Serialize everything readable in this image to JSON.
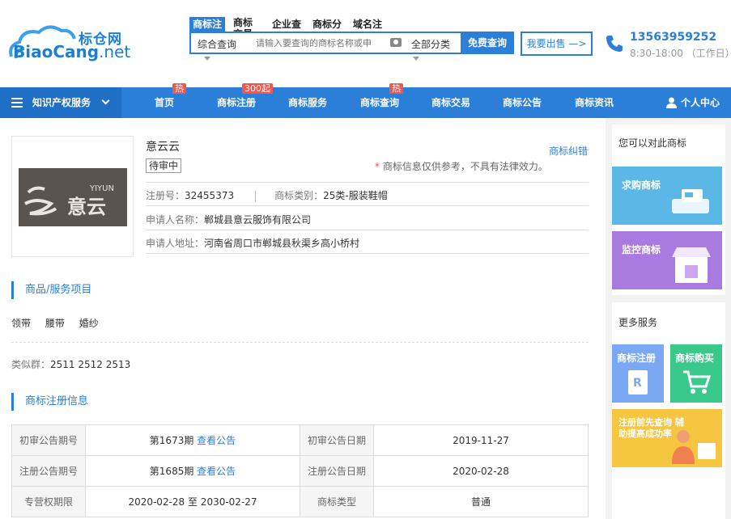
{
  "header": {
    "logo_cn": "标仓网",
    "logo_en_main": "BiaoCang",
    "logo_en_suffix": ".net",
    "search_tabs": [
      "商标注",
      "商标交易",
      "企业查",
      "商标分",
      "域名注"
    ],
    "search_category": "综合查询",
    "search_placeholder": "请输入要查询的商标名称或申",
    "search_all_category": "全部分类",
    "search_button": "免费查询",
    "sell_button": "我要出售 —>",
    "phone_number": "13563959252",
    "phone_hours": "8:30-18:00 （工作日）"
  },
  "nav": {
    "ip_services": "知识产权服务",
    "items": [
      {
        "label": "首页",
        "badge": "热"
      },
      {
        "label": "商标注册",
        "badge": "300起"
      },
      {
        "label": "商标服务",
        "badge": ""
      },
      {
        "label": "商标查询",
        "badge": "热"
      },
      {
        "label": "商标交易",
        "badge": ""
      },
      {
        "label": "商标公告",
        "badge": ""
      },
      {
        "label": "商标资讯",
        "badge": ""
      }
    ],
    "user_center": "个人中心"
  },
  "trademark": {
    "image_text_en": "YIYUN",
    "image_text_cn": "意云",
    "name": "意云云",
    "status": "待审中",
    "dispute_link": "商标纠错",
    "note_star": "*",
    "note": " 商标信息仅供参考，不具有法律效力。",
    "reg_no_label": "注册号：",
    "reg_no": "32455373",
    "class_label": "商标类别：",
    "class_value": "25类-服装鞋帽",
    "applicant_label": "申请人名称：",
    "applicant": "郸城县意云服饰有限公司",
    "address_label": "申请人地址：",
    "address": "河南省周口市郸城县秋渠乡高小桥村"
  },
  "goods_section": {
    "title": "商品/服务项目",
    "items": [
      "领带",
      "腰带",
      "婚纱"
    ],
    "similar_label": "类似群：",
    "similar_value": "2511 2512 2513"
  },
  "reg_section": {
    "title": "商标注册信息",
    "rows": [
      {
        "h1": "初审公告期号",
        "v1": "第1673期",
        "v1_link": "查看公告",
        "h2": "初审公告日期",
        "v2": "2019-11-27"
      },
      {
        "h1": "注册公告期号",
        "v1": "第1685期",
        "v1_link": "查看公告",
        "h2": "注册公告日期",
        "v2": "2020-02-28"
      },
      {
        "h1": "专营权期限",
        "v1": "2020-02-28 至 2030-02-27",
        "v1_link": "",
        "h2": "商标类型",
        "v2": "普通"
      }
    ]
  },
  "sidebar": {
    "panel1_title": "您可以对此商标",
    "card_buy": "求购商标",
    "card_monitor": "监控商标",
    "panel2_title": "更多服务",
    "small_register": "商标注册",
    "small_purchase": "商标购买",
    "wide_card": "注册前先查询 辅助提高成功率"
  },
  "colors": {
    "primary": "#2b7fd8",
    "badge": "#f5554a",
    "card_buy": "#5bb8e6",
    "card_monitor": "#a97be0",
    "small_register": "#7ba8f2",
    "small_purchase": "#39c98a",
    "wide_card": "#f7c640"
  }
}
